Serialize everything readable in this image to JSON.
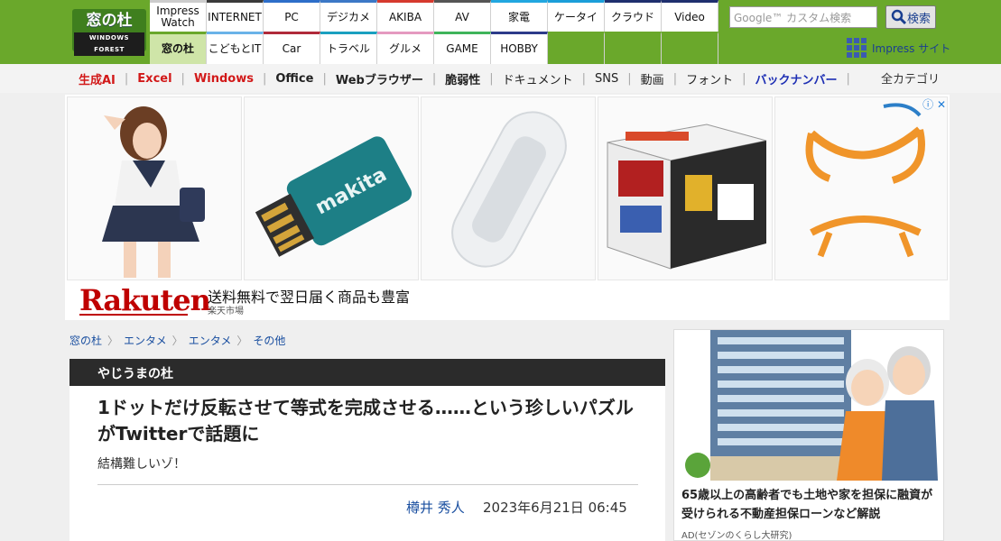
{
  "logo": {
    "main": "窓の杜",
    "sub": "WINDOWS FOREST"
  },
  "nav": {
    "row1": [
      "Impress Watch",
      "INTERNET",
      "PC",
      "デジカメ",
      "AKIBA",
      "AV",
      "家電",
      "ケータイ",
      "クラウド",
      "Video"
    ],
    "row2": [
      "窓の杜",
      "こどもとIT",
      "Car",
      "トラベル",
      "グルメ",
      "GAME",
      "HOBBY"
    ],
    "colors1": [
      "#cccccc",
      "#3a3a3a",
      "#2d6ec9",
      "#3c78c6",
      "#d63a2e",
      "#555555",
      "#22a7e0",
      "#1b9ed9",
      "#1f2f6e",
      "#1f2f6e"
    ],
    "colors2": [
      "#6aa82b",
      "#6ab3e8",
      "#b02a3a",
      "#1aa0c0",
      "#e59ac0",
      "#3fb45b",
      "#2d3b8a"
    ]
  },
  "search": {
    "placeholder": "Google™ カスタム検索",
    "button": "検索"
  },
  "impress_link": "Impress サイト",
  "categories": [
    "生成AI",
    "Excel",
    "Windows",
    "Office",
    "Webブラウザー",
    "脆弱性",
    "ドキュメント",
    "SNS",
    "動画",
    "フォント",
    "バックナンバー"
  ],
  "all_categories": "全カテゴリ",
  "ad": {
    "brand": "Rakuten",
    "text": "送料無料で翌日届く商品も豊富",
    "source": "楽天市場",
    "info": "ⓘ ✕"
  },
  "breadcrumb": [
    "窓の杜",
    "エンタメ",
    "エンタメ",
    "その他"
  ],
  "article": {
    "series": "やじうまの杜",
    "title": "1ドットだけ反転させて等式を完成させる……という珍しいパズルがTwitterで話題に",
    "subtitle": "結構難しいゾ！",
    "author": "樽井 秀人",
    "date": "2023年6月21日 06:45"
  },
  "side_ad": {
    "text": "65歳以上の高齢者でも土地や家を担保に融資が受けられる不動産担保ローンなど解説",
    "source": "AD(セゾンのくらし大研究)"
  }
}
